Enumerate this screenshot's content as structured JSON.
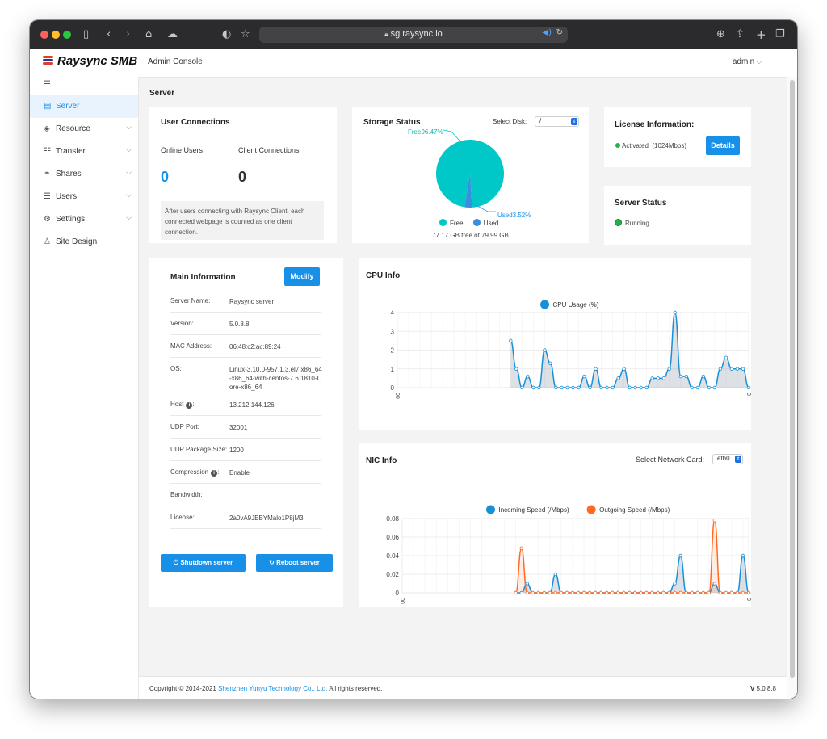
{
  "browser": {
    "url": "sg.raysync.io",
    "buttons": [
      "sidebar-icon",
      "back-icon",
      "forward-icon",
      "home-icon",
      "cloud-icon",
      "shield-icon",
      "star-icon",
      "download-icon",
      "share-icon",
      "new-tab-icon",
      "tabs-icon"
    ]
  },
  "header": {
    "logo": "Raysync SMB",
    "title": "Admin Console",
    "user": "admin"
  },
  "sidebar": {
    "items": [
      {
        "label": "Server",
        "icon": "server-icon",
        "active": true,
        "chevron": false
      },
      {
        "label": "Resource",
        "icon": "layers-icon",
        "active": false,
        "chevron": true
      },
      {
        "label": "Transfer",
        "icon": "list-icon",
        "active": false,
        "chevron": true
      },
      {
        "label": "Shares",
        "icon": "link-icon",
        "active": false,
        "chevron": true
      },
      {
        "label": "Users",
        "icon": "users-icon",
        "active": false,
        "chevron": true
      },
      {
        "label": "Settings",
        "icon": "gear-icon",
        "active": false,
        "chevron": true
      },
      {
        "label": "Site Design",
        "icon": "shirt-icon",
        "active": false,
        "chevron": false
      }
    ]
  },
  "page": {
    "title": "Server"
  },
  "user_connections": {
    "title": "User Connections",
    "online_label": "Online Users",
    "online_value": "0",
    "client_label": "Client Connections",
    "client_value": "0",
    "note": "After users connecting with Raysync Client, each connected webpage is counted as one client connection."
  },
  "storage": {
    "title": "Storage Status",
    "select_label": "Select Disk:",
    "disk": "/",
    "free_label": "Free96.47%",
    "used_label": "Used3.52%",
    "legend_free": "Free",
    "legend_used": "Used",
    "summary": "77.17 GB free of 79.99 GB",
    "free_pct": 96.47,
    "used_pct": 3.52
  },
  "license": {
    "title": "License Information:",
    "status": "Activated",
    "speed": "(1024Mbps)",
    "details_label": "Details"
  },
  "server_status": {
    "title": "Server Status",
    "status": "Running"
  },
  "main_info": {
    "title": "Main Information",
    "modify_label": "Modify",
    "rows": [
      {
        "key": "Server Name:",
        "value": "Raysync server",
        "info": false
      },
      {
        "key": "Version:",
        "value": "5.0.8.8",
        "info": false
      },
      {
        "key": "MAC Address:",
        "value": "06:48:c2:ac:89:24",
        "info": false
      },
      {
        "key": "OS:",
        "value": "Linux-3.10.0-957.1.3.el7.x86_64-x86_64-with-centos-7.6.1810-Core-x86_64",
        "info": false
      },
      {
        "key": "Host",
        "value": "13.212.144.126",
        "info": true
      },
      {
        "key": "UDP Port:",
        "value": "32001",
        "info": false
      },
      {
        "key": "UDP Package Size:",
        "value": "1200",
        "info": false
      },
      {
        "key": "Compression",
        "value": "Enable",
        "info": true
      },
      {
        "key": "Bandwidth:",
        "value": "",
        "info": false
      },
      {
        "key": "License:",
        "value": "2a0vA9JEBYMalo1P8jM3",
        "info": false
      }
    ],
    "shutdown_label": "Shutdown server",
    "reboot_label": "Reboot server"
  },
  "cpu": {
    "title": "CPU Info"
  },
  "nic": {
    "title": "NIC Info",
    "select_label": "Select Network Card:",
    "card": "eth0"
  },
  "footer": {
    "copyright": "Copyright © 2014-2021",
    "company": "Shenzhen Yunyu Technology Co., Ltd.",
    "rights": "All rights reserved.",
    "version_prefix": "V",
    "version": "5.0.8.8"
  },
  "chart_data": [
    {
      "type": "area",
      "title": "CPU Info",
      "series": [
        {
          "name": "CPU Usage (%)",
          "color": "#1890d8",
          "values": [
            null,
            null,
            null,
            null,
            null,
            null,
            null,
            null,
            null,
            null,
            null,
            null,
            null,
            null,
            null,
            null,
            null,
            null,
            null,
            null,
            2.5,
            1,
            0,
            0.6,
            0,
            0,
            2,
            1.3,
            0,
            0,
            0,
            0,
            0,
            0.6,
            0,
            1,
            0,
            0,
            0,
            0.5,
            1,
            0,
            0,
            0,
            0,
            0.5,
            0.5,
            0.5,
            1,
            4,
            0.6,
            0.6,
            0,
            0,
            0.6,
            0,
            0,
            1,
            1.6,
            1,
            1,
            1,
            0
          ]
        }
      ],
      "x_tick_labels": [
        "00",
        "0"
      ],
      "ylim": [
        0,
        4
      ],
      "yticks": [
        0,
        1,
        2,
        3,
        4
      ],
      "grid": true,
      "legend": "top-center"
    },
    {
      "type": "area",
      "title": "NIC Info",
      "series": [
        {
          "name": "Incoming Speed (/Mbps)",
          "color": "#1890d8",
          "values": [
            null,
            null,
            null,
            null,
            null,
            null,
            null,
            null,
            null,
            null,
            null,
            null,
            null,
            null,
            null,
            null,
            null,
            null,
            null,
            null,
            0,
            0,
            0.01,
            0,
            0,
            0,
            0,
            0.02,
            0,
            0,
            0,
            0,
            0,
            0,
            0,
            0,
            0,
            0,
            0,
            0,
            0,
            0,
            0,
            0,
            0,
            0,
            0,
            0,
            0.01,
            0.04,
            0,
            0,
            0,
            0,
            0,
            0.01,
            0,
            0,
            0,
            0,
            0.04,
            0
          ]
        },
        {
          "name": "Outgoing Speed (/Mbps)",
          "color": "#ff6a22",
          "values": [
            null,
            null,
            null,
            null,
            null,
            null,
            null,
            null,
            null,
            null,
            null,
            null,
            null,
            null,
            null,
            null,
            null,
            null,
            null,
            null,
            0,
            0.048,
            0,
            0,
            0,
            0,
            0,
            0,
            0,
            0,
            0,
            0,
            0,
            0,
            0,
            0,
            0,
            0,
            0,
            0,
            0,
            0,
            0,
            0,
            0,
            0,
            0,
            0,
            0,
            0,
            0,
            0,
            0,
            0,
            0,
            0.078,
            0,
            0,
            0,
            0,
            0,
            0
          ]
        }
      ],
      "x_tick_labels": [
        "00",
        "0"
      ],
      "ylim": [
        0,
        0.08
      ],
      "yticks": [
        "0",
        "0.02",
        "0.04",
        "0.06",
        "0.08"
      ],
      "grid": true,
      "legend": "top-center"
    }
  ]
}
